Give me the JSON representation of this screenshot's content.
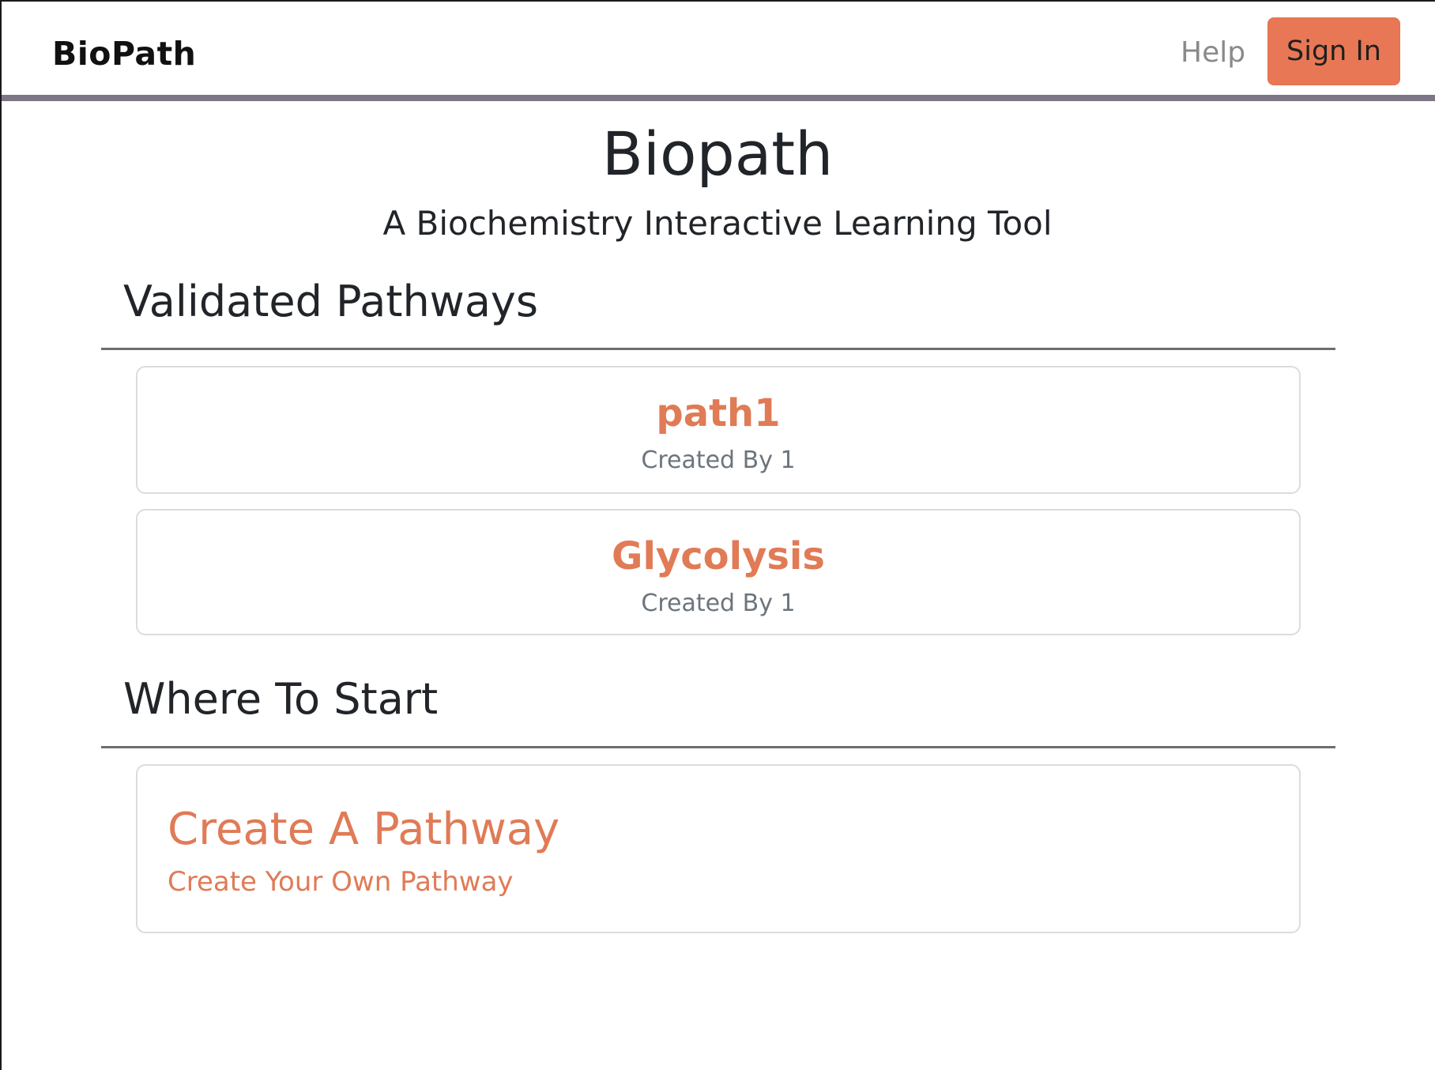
{
  "header": {
    "brand": "BioPath",
    "help_label": "Help",
    "signin_label": "Sign In"
  },
  "hero": {
    "title": "Biopath",
    "subtitle": "A Biochemistry Interactive Learning Tool"
  },
  "validated": {
    "heading": "Validated Pathways",
    "pathways": [
      {
        "name": "path1",
        "created_by": "Created By 1"
      },
      {
        "name": "Glycolysis",
        "created_by": "Created By 1"
      }
    ]
  },
  "start": {
    "heading": "Where To Start",
    "card": {
      "title": "Create A Pathway",
      "subtitle": "Create Your Own Pathway"
    }
  },
  "colors": {
    "accent": "#e87855",
    "nav_rule": "#7d7785"
  }
}
